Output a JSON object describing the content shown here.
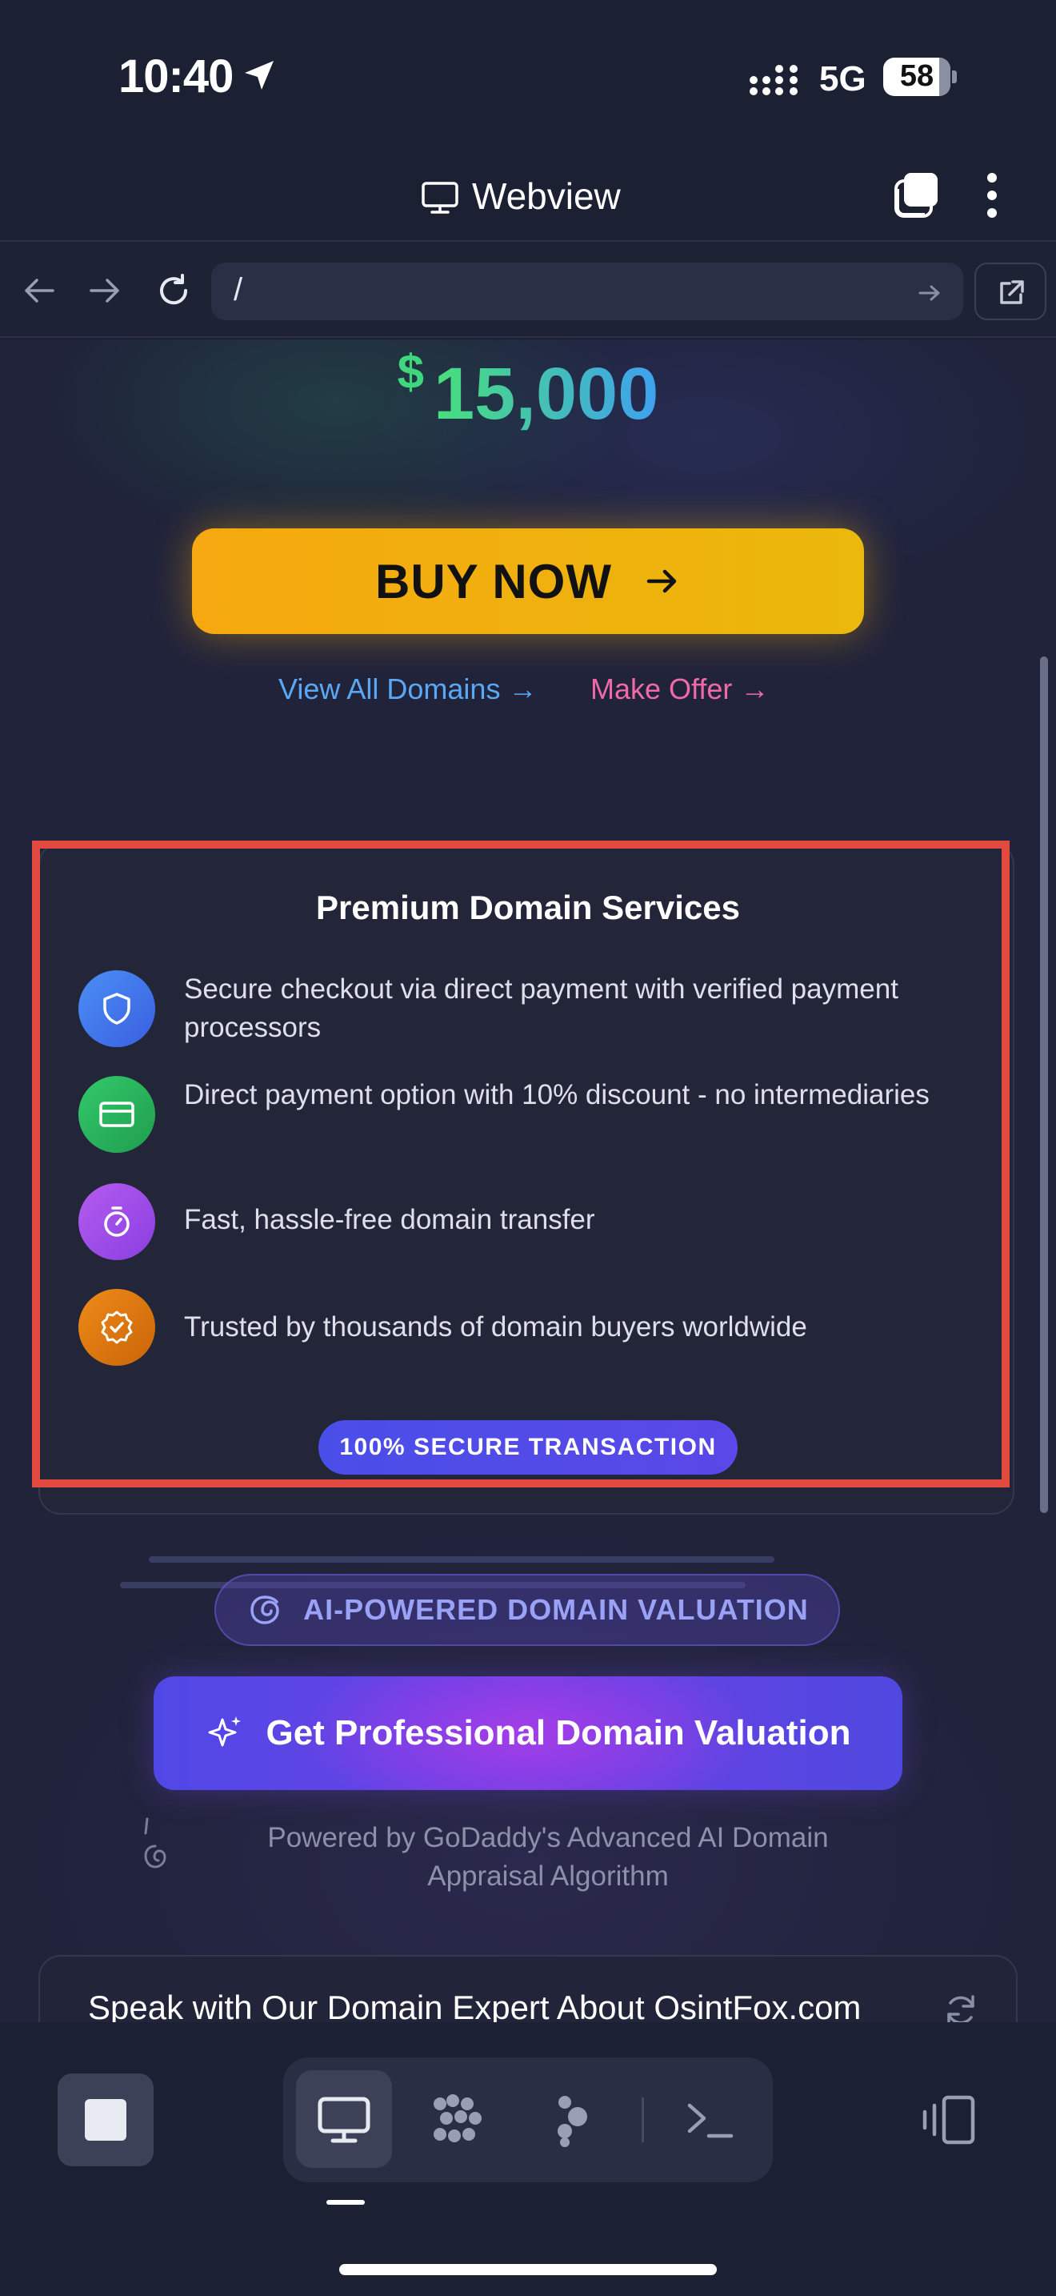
{
  "status_bar": {
    "time": "10:40",
    "network": "5G",
    "battery": "58"
  },
  "header": {
    "title": "Webview"
  },
  "url_bar": {
    "value": "/"
  },
  "price": {
    "currency": "$",
    "amount": "15,000"
  },
  "actions": {
    "buy_now": "BUY NOW",
    "view_all": "View All Domains →",
    "make_offer": "Make Offer →"
  },
  "services": {
    "title": "Premium Domain Services",
    "items": [
      {
        "text": "Secure checkout via direct payment with verified payment processors",
        "icon": "shield-icon",
        "color": "#3f7bf0"
      },
      {
        "text": "Direct payment option with 10% discount - no intermediaries",
        "icon": "credit-card-icon",
        "color": "#27b35a"
      },
      {
        "text": "Fast, hassle-free domain transfer",
        "icon": "stopwatch-icon",
        "color": "#a24ee8"
      },
      {
        "text": "Trusted by thousands of domain buyers worldwide",
        "icon": "verified-badge-icon",
        "color": "#e07a10"
      }
    ],
    "badge": "100% SECURE TRANSACTION"
  },
  "valuation": {
    "badge": "AI-POWERED DOMAIN VALUATION",
    "button": "Get Professional Domain Valuation",
    "powered_by": "Powered by GoDaddy's Advanced AI Domain Appraisal Algorithm"
  },
  "expert": {
    "title": "Speak with Our Domain Expert About OsintFox.com"
  },
  "colors": {
    "accent_yellow": "#f5a80f",
    "highlight_red": "#e34a3f",
    "brand_purple": "#5048e6"
  }
}
